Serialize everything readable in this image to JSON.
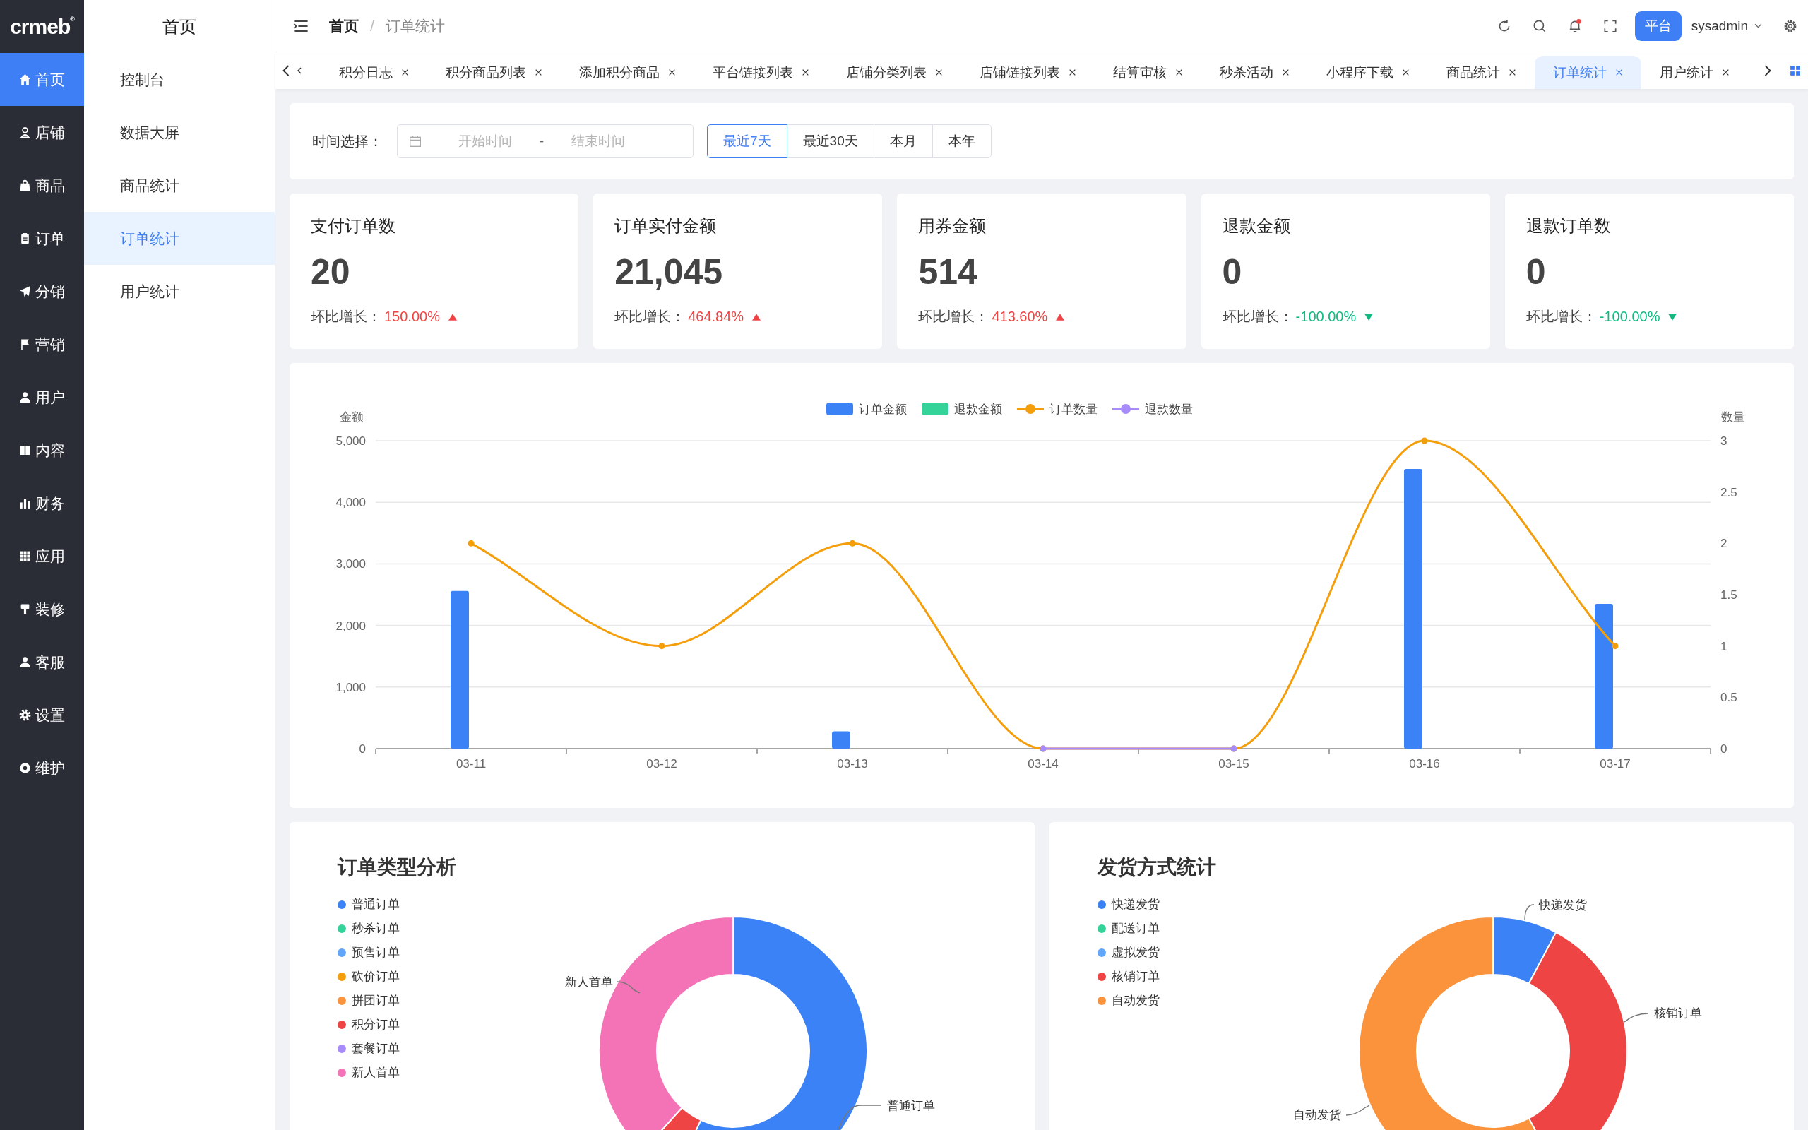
{
  "rail": {
    "logo": "crmeb",
    "logo_mark": "®",
    "items": [
      {
        "label": "首页",
        "selected": true
      },
      {
        "label": "店铺",
        "selected": false
      },
      {
        "label": "商品",
        "selected": false
      },
      {
        "label": "订单",
        "selected": false
      },
      {
        "label": "分销",
        "selected": false
      },
      {
        "label": "营销",
        "selected": false
      },
      {
        "label": "用户",
        "selected": false
      },
      {
        "label": "内容",
        "selected": false
      },
      {
        "label": "财务",
        "selected": false
      },
      {
        "label": "应用",
        "selected": false
      },
      {
        "label": "装修",
        "selected": false
      },
      {
        "label": "客服",
        "selected": false
      },
      {
        "label": "设置",
        "selected": false
      },
      {
        "label": "维护",
        "selected": false
      }
    ]
  },
  "submenu": {
    "title": "首页",
    "items": [
      {
        "label": "控制台",
        "selected": false
      },
      {
        "label": "数据大屏",
        "selected": false
      },
      {
        "label": "商品统计",
        "selected": false
      },
      {
        "label": "订单统计",
        "selected": true
      },
      {
        "label": "用户统计",
        "selected": false
      }
    ]
  },
  "header": {
    "breadcrumb": [
      "首页",
      "订单统计"
    ],
    "separator": "/",
    "notification_dot": true,
    "platform_button": "平台",
    "user": "sysadmin"
  },
  "tabs": [
    {
      "label": "积分日志",
      "selected": false
    },
    {
      "label": "积分商品列表",
      "selected": false
    },
    {
      "label": "添加积分商品",
      "selected": false
    },
    {
      "label": "平台链接列表",
      "selected": false
    },
    {
      "label": "店铺分类列表",
      "selected": false
    },
    {
      "label": "店铺链接列表",
      "selected": false
    },
    {
      "label": "结算审核",
      "selected": false
    },
    {
      "label": "秒杀活动",
      "selected": false
    },
    {
      "label": "小程序下载",
      "selected": false
    },
    {
      "label": "商品统计",
      "selected": false
    },
    {
      "label": "订单统计",
      "selected": true
    },
    {
      "label": "用户统计",
      "selected": false
    }
  ],
  "filter": {
    "label": "时间选择：",
    "start_placeholder": "开始时间",
    "range_separator": "-",
    "end_placeholder": "结束时间",
    "ranges": [
      {
        "label": "最近7天",
        "selected": true
      },
      {
        "label": "最近30天",
        "selected": false
      },
      {
        "label": "本月",
        "selected": false
      },
      {
        "label": "本年",
        "selected": false
      }
    ]
  },
  "stats": [
    {
      "title": "支付订单数",
      "value": "20",
      "growth_label": "环比增长：",
      "growth": "150.00%",
      "kind": "up"
    },
    {
      "title": "订单实付金额",
      "value": "21,045",
      "growth_label": "环比增长：",
      "growth": "464.84%",
      "kind": "up"
    },
    {
      "title": "用券金额",
      "value": "514",
      "growth_label": "环比增长：",
      "growth": "413.60%",
      "kind": "up"
    },
    {
      "title": "退款金额",
      "value": "0",
      "growth_label": "环比增长：",
      "growth": "-100.00%",
      "kind": "down"
    },
    {
      "title": "退款订单数",
      "value": "0",
      "growth_label": "环比增长：",
      "growth": "-100.00%",
      "kind": "down"
    }
  ],
  "trend_chart": {
    "bars": {
      "chart_data": {
        "type": "bar",
        "grid": true,
        "legend": "top",
        "categories": [
          "03-11",
          "03-12",
          "03-13",
          "03-14",
          "03-15",
          "03-16",
          "03-17"
        ],
        "ylabel": "金额",
        "ylim": [
          0,
          5000
        ],
        "yticks": [
          {
            "value": 0,
            "label": "0"
          },
          {
            "value": 1000,
            "label": "1,000"
          },
          {
            "value": 2000,
            "label": "2,000"
          },
          {
            "value": 3000,
            "label": "3,000"
          },
          {
            "value": 4000,
            "label": "4,000"
          },
          {
            "value": 5000,
            "label": "5,000"
          }
        ],
        "series": [
          {
            "name": "订单金额",
            "color": "#3b82f6",
            "values": [
              2560,
              0,
              280,
              0,
              0,
              4540,
              2350
            ]
          },
          {
            "name": "退款金额",
            "color": "#34d399",
            "values": [
              0,
              0,
              0,
              0,
              0,
              0,
              0
            ]
          }
        ]
      }
    },
    "lines": {
      "chart_data": {
        "type": "line",
        "legend": "top",
        "ylabel": "数量",
        "ylim": [
          0,
          3
        ],
        "yticks": [
          0,
          0.5,
          1,
          1.5,
          2,
          2.5,
          3
        ],
        "series": [
          {
            "name": "订单数量",
            "color": "#f59e0b",
            "marker": true,
            "values": [
              2,
              1,
              2,
              0,
              0,
              3,
              1
            ]
          },
          {
            "name": "退款数量",
            "color": "#a78bfa",
            "marker": true,
            "values": [
              null,
              null,
              null,
              0,
              0,
              null,
              null
            ]
          }
        ]
      }
    }
  },
  "order_types": {
    "title": "订单类型分析",
    "legend": [
      {
        "name": "普通订单",
        "color": "#3b82f6"
      },
      {
        "name": "秒杀订单",
        "color": "#34d399"
      },
      {
        "name": "预售订单",
        "color": "#60a5fa"
      },
      {
        "name": "砍价订单",
        "color": "#f59e0b"
      },
      {
        "name": "拼团订单",
        "color": "#fb923c"
      },
      {
        "name": "积分订单",
        "color": "#ef4444"
      },
      {
        "name": "套餐订单",
        "color": "#a78bfa"
      },
      {
        "name": "新人首单",
        "color": "#f472b6"
      }
    ],
    "slice_labels": [
      "新人首单",
      "普通订单"
    ]
  },
  "shipping": {
    "title": "发货方式统计",
    "legend": [
      {
        "name": "快递发货",
        "color": "#3b82f6"
      },
      {
        "name": "配送订单",
        "color": "#34d399"
      },
      {
        "name": "虚拟发货",
        "color": "#60a5fa"
      },
      {
        "name": "核销订单",
        "color": "#ef4444"
      },
      {
        "name": "自动发货",
        "color": "#fb923c"
      }
    ],
    "slice_labels": [
      "快递发货",
      "核销订单",
      "自动发货"
    ]
  }
}
